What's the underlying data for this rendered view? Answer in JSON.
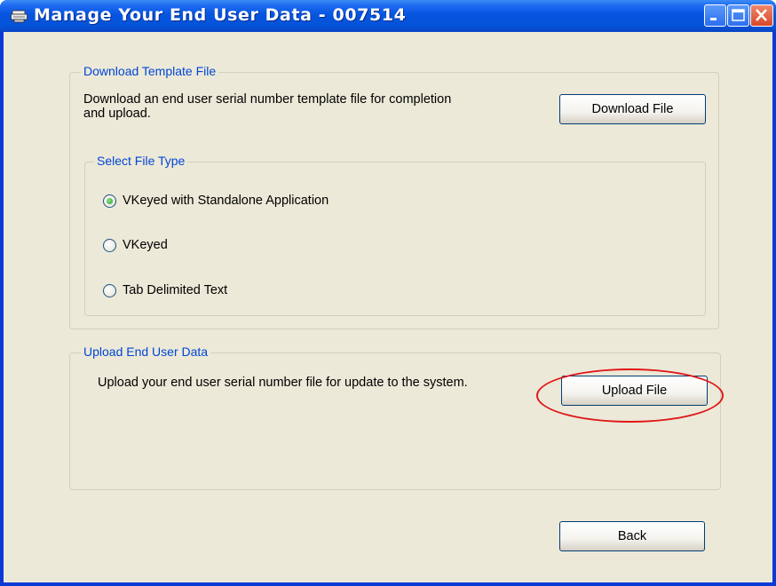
{
  "window": {
    "title": "Manage Your End User Data - 007514",
    "controls": {
      "minimize": "minimize",
      "maximize": "maximize",
      "close": "close"
    }
  },
  "download_group": {
    "legend": "Download Template File",
    "description_line1": "Download an end user serial number template file for completion",
    "description_line2": "and upload.",
    "button_label": "Download File",
    "file_type_group": {
      "legend": "Select File Type",
      "options": [
        {
          "label": "VKeyed with Standalone Application",
          "selected": true
        },
        {
          "label": "VKeyed",
          "selected": false
        },
        {
          "label": "Tab Delimited Text",
          "selected": false
        }
      ]
    }
  },
  "upload_group": {
    "legend": "Upload End User Data",
    "description": "Upload your end user serial number file for update to the system.",
    "button_label": "Upload File",
    "highlight_color": "#e01818"
  },
  "footer": {
    "back_label": "Back"
  },
  "colors": {
    "titlebar": "#0553d8",
    "legend_text": "#0046d5",
    "client_bg": "#ece9d8"
  }
}
